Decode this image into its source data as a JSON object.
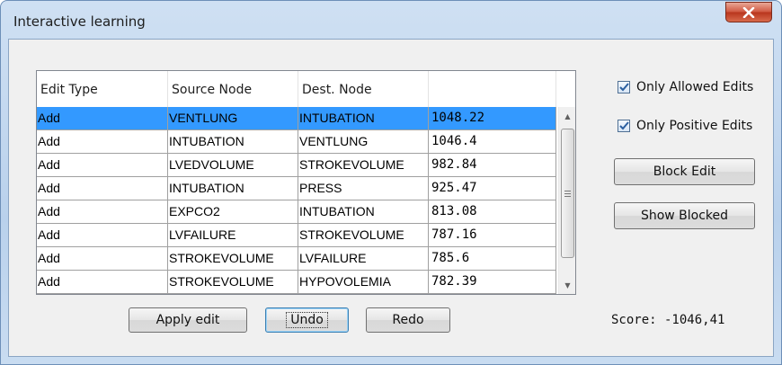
{
  "window": {
    "title": "Interactive learning",
    "close_glyph": "x"
  },
  "grid": {
    "columns": [
      "Edit Type",
      "Source Node",
      "Dest. Node",
      ""
    ],
    "rows": [
      {
        "edit_type": "Add",
        "source": "VENTLUNG",
        "dest": "INTUBATION",
        "value": "1048.22",
        "selected": true
      },
      {
        "edit_type": "Add",
        "source": "INTUBATION",
        "dest": "VENTLUNG",
        "value": "1046.4"
      },
      {
        "edit_type": "Add",
        "source": "LVEDVOLUME",
        "dest": "STROKEVOLUME",
        "value": "982.84"
      },
      {
        "edit_type": "Add",
        "source": "INTUBATION",
        "dest": "PRESS",
        "value": "925.47"
      },
      {
        "edit_type": "Add",
        "source": "EXPCO2",
        "dest": "INTUBATION",
        "value": "813.08"
      },
      {
        "edit_type": "Add",
        "source": "LVFAILURE",
        "dest": "STROKEVOLUME",
        "value": "787.16"
      },
      {
        "edit_type": "Add",
        "source": "STROKEVOLUME",
        "dest": "LVFAILURE",
        "value": "785.6"
      },
      {
        "edit_type": "Add",
        "source": "STROKEVOLUME",
        "dest": "HYPOVOLEMIA",
        "value": "782.39"
      }
    ],
    "scroll": {
      "up_glyph": "▲",
      "down_glyph": "▼"
    }
  },
  "options": {
    "only_allowed_edits": {
      "label": "Only Allowed Edits",
      "checked": true
    },
    "only_positive_edits": {
      "label": "Only Positive Edits",
      "checked": true
    }
  },
  "buttons": {
    "block_edit": "Block Edit",
    "show_blocked": "Show Blocked",
    "apply_edit": "Apply edit",
    "undo": "Undo",
    "redo": "Redo"
  },
  "score": "Score: -1046,41",
  "colors": {
    "selection": "#3399ff",
    "title_bar": "#b9d1ec",
    "close_button": "#c8452c",
    "checkbox_check": "#2b5fa0"
  },
  "icons": {
    "close": "close-icon",
    "check": "checkmark-icon",
    "scroll_up": "arrow-up-icon",
    "scroll_down": "arrow-down-icon",
    "thumb_grip": "grip-icon"
  }
}
